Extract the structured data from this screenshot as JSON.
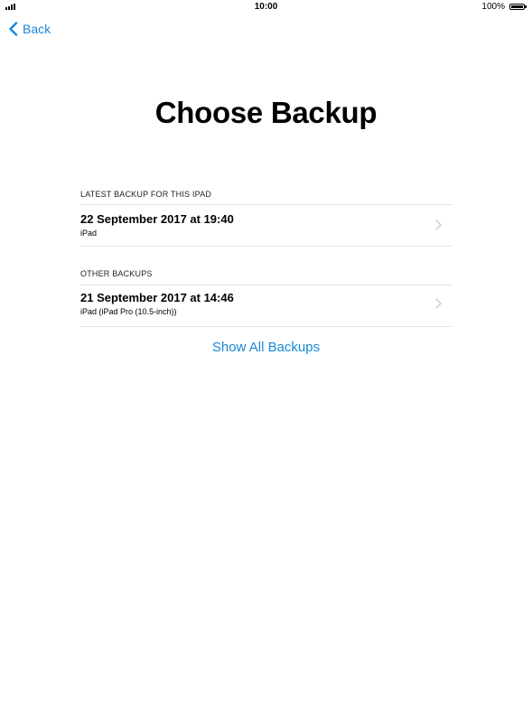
{
  "status_bar": {
    "time": "10:00",
    "battery_text": "100%",
    "signal_icon": "signal-bars-icon",
    "battery_icon": "battery-full-icon"
  },
  "nav": {
    "back_label": "Back",
    "back_icon": "chevron-left-icon"
  },
  "page": {
    "title": "Choose Backup"
  },
  "sections": [
    {
      "header": "LATEST BACKUP FOR THIS IPAD",
      "rows": [
        {
          "date": "22 September 2017 at 19:40",
          "device": "iPad"
        }
      ]
    },
    {
      "header": "OTHER BACKUPS",
      "rows": [
        {
          "date": "21 September 2017 at 14:46",
          "device": "iPad (iPad Pro (10.5-inch))"
        }
      ]
    }
  ],
  "show_all_label": "Show All Backups",
  "colors": {
    "accent": "#1a87d9",
    "divider": "#e3e3e6",
    "chevron": "#c7c7cc"
  }
}
